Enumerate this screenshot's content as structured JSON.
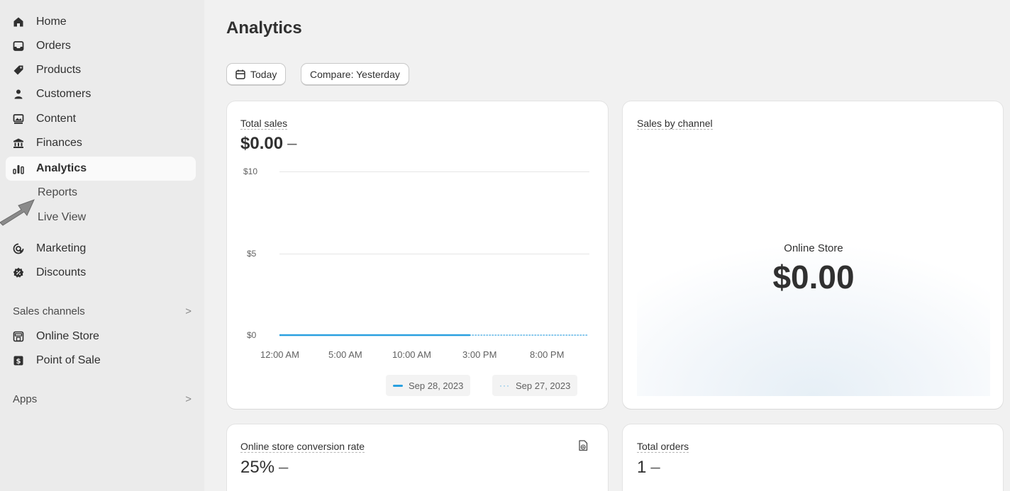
{
  "sidebar": {
    "items": [
      {
        "label": "Home",
        "icon": "home-icon"
      },
      {
        "label": "Orders",
        "icon": "inbox-icon"
      },
      {
        "label": "Products",
        "icon": "tag-icon"
      },
      {
        "label": "Customers",
        "icon": "person-icon"
      },
      {
        "label": "Content",
        "icon": "image-icon"
      },
      {
        "label": "Finances",
        "icon": "bank-icon"
      },
      {
        "label": "Analytics",
        "icon": "bar-chart-icon",
        "active": true
      }
    ],
    "analytics_sub": [
      {
        "label": "Reports"
      },
      {
        "label": "Live View"
      }
    ],
    "items2": [
      {
        "label": "Marketing",
        "icon": "target-icon"
      },
      {
        "label": "Discounts",
        "icon": "discount-icon"
      }
    ],
    "sales_channels": {
      "heading": "Sales channels",
      "chevron": ">",
      "items": [
        {
          "label": "Online Store",
          "icon": "store-icon"
        },
        {
          "label": "Point of Sale",
          "icon": "pos-icon"
        }
      ]
    },
    "apps": {
      "heading": "Apps",
      "chevron": ">"
    }
  },
  "main": {
    "title": "Analytics",
    "date_button": "Today",
    "compare_button": "Compare: Yesterday",
    "total_sales": {
      "label": "Total sales",
      "value": "$0.00",
      "change": "–"
    },
    "sales_by_channel": {
      "label": "Sales by channel",
      "channel": "Online Store",
      "value": "$0.00"
    },
    "conversion": {
      "label": "Online store conversion rate",
      "value": "25%",
      "change": "–"
    },
    "total_orders": {
      "label": "Total orders",
      "value": "1",
      "change": "–"
    }
  },
  "chart_data": {
    "type": "line",
    "title": "",
    "xlabel": "",
    "ylabel": "",
    "ylim": [
      0,
      10
    ],
    "y_ticks": [
      "$10",
      "$5",
      "$0"
    ],
    "x_ticks": [
      "12:00 AM",
      "5:00 AM",
      "10:00 AM",
      "3:00 PM",
      "8:00 PM"
    ],
    "x": [
      "12:00 AM",
      "5:00 AM",
      "10:00 AM",
      "3:00 PM",
      "8:00 PM"
    ],
    "series": [
      {
        "name": "Sep 28, 2023",
        "values": [
          0,
          0,
          0,
          0
        ],
        "style": "solid",
        "color": "#2aa0e0"
      },
      {
        "name": "Sep 27, 2023",
        "values": [
          0,
          0,
          0,
          0,
          0
        ],
        "style": "dotted",
        "color": "#5ab3e6"
      }
    ],
    "grid": true,
    "legend": "bottom-right"
  }
}
